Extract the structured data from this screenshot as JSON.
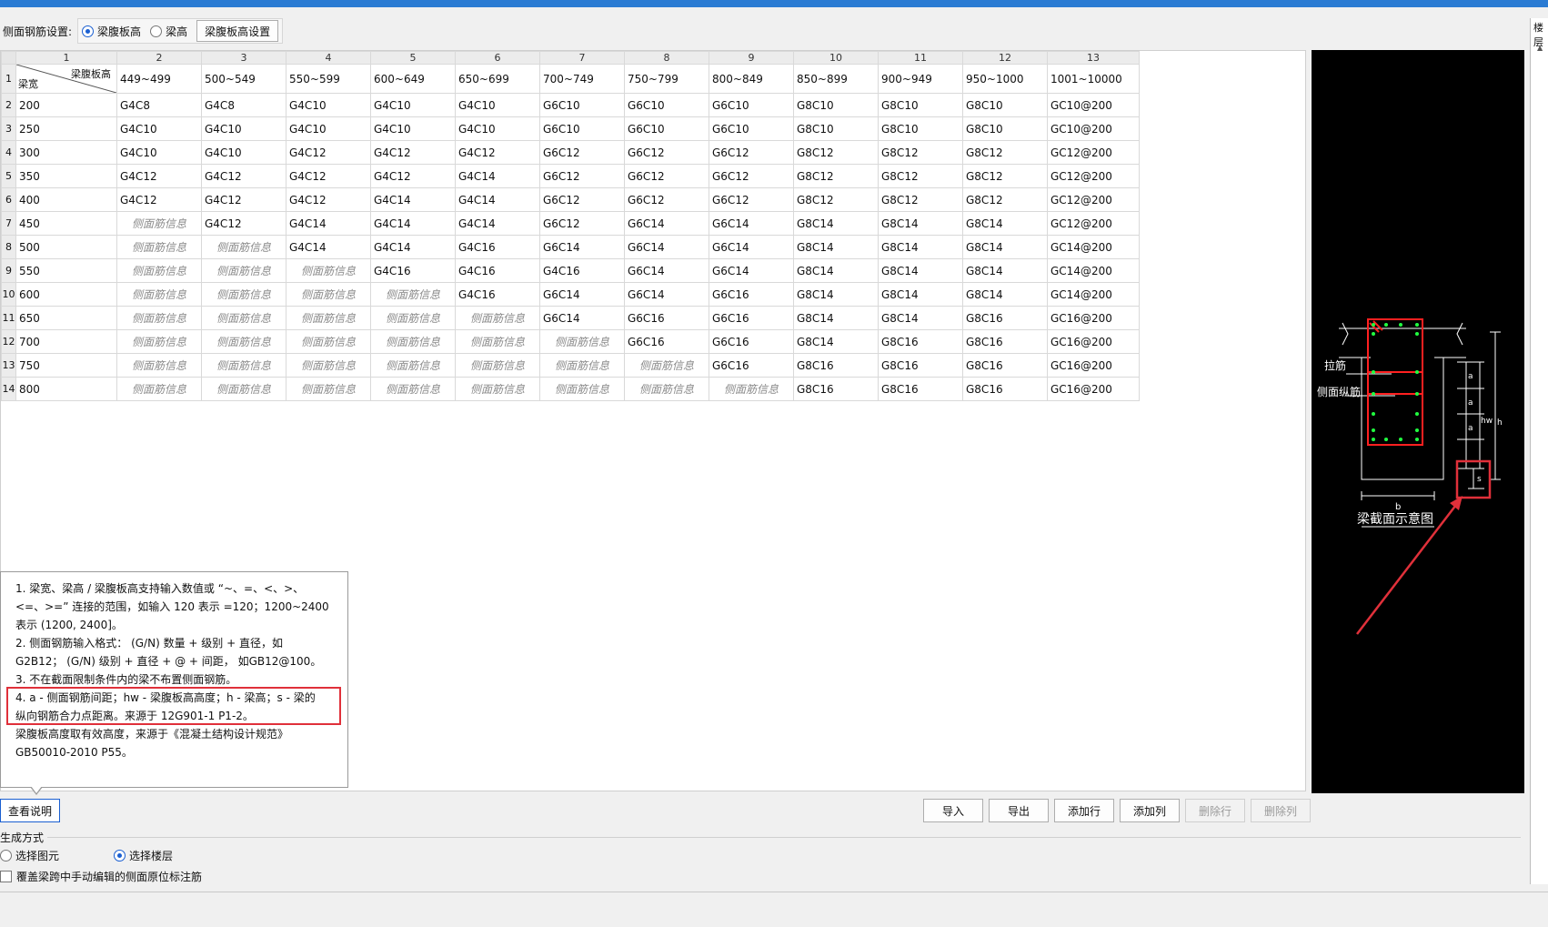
{
  "setting": {
    "label": "侧面钢筋设置:",
    "radio_web_height": "梁腹板高",
    "radio_beam_height": "梁高",
    "web_height_settings_button": "梁腹板高设置"
  },
  "grid": {
    "col_numbers": [
      "1",
      "2",
      "3",
      "4",
      "5",
      "6",
      "7",
      "8",
      "9",
      "10",
      "11",
      "12",
      "13"
    ],
    "corner_top": "梁腹板高",
    "corner_bottom": "梁宽",
    "header_ranges": [
      "449~499",
      "500~549",
      "550~599",
      "600~649",
      "650~699",
      "700~749",
      "750~799",
      "800~849",
      "850~899",
      "900~949",
      "950~1000",
      "1001~10000"
    ],
    "placeholder": "侧面筋信息",
    "rows": [
      {
        "no": "2",
        "width": "200",
        "cells": [
          "G4C8",
          "G4C8",
          "G4C10",
          "G4C10",
          "G4C10",
          "G6C10",
          "G6C10",
          "G6C10",
          "G8C10",
          "G8C10",
          "G8C10",
          "GC10@200"
        ]
      },
      {
        "no": "3",
        "width": "250",
        "cells": [
          "G4C10",
          "G4C10",
          "G4C10",
          "G4C10",
          "G4C10",
          "G6C10",
          "G6C10",
          "G6C10",
          "G8C10",
          "G8C10",
          "G8C10",
          "GC10@200"
        ]
      },
      {
        "no": "4",
        "width": "300",
        "cells": [
          "G4C10",
          "G4C10",
          "G4C12",
          "G4C12",
          "G4C12",
          "G6C12",
          "G6C12",
          "G6C12",
          "G8C12",
          "G8C12",
          "G8C12",
          "GC12@200"
        ]
      },
      {
        "no": "5",
        "width": "350",
        "cells": [
          "G4C12",
          "G4C12",
          "G4C12",
          "G4C12",
          "G4C14",
          "G6C12",
          "G6C12",
          "G6C12",
          "G8C12",
          "G8C12",
          "G8C12",
          "GC12@200"
        ]
      },
      {
        "no": "6",
        "width": "400",
        "cells": [
          "G4C12",
          "G4C12",
          "G4C12",
          "G4C14",
          "G4C14",
          "G6C12",
          "G6C12",
          "G6C12",
          "G8C12",
          "G8C12",
          "G8C12",
          "GC12@200"
        ]
      },
      {
        "no": "7",
        "width": "450",
        "cells": [
          "",
          "G4C12",
          "G4C14",
          "G4C14",
          "G4C14",
          "G6C12",
          "G6C14",
          "G6C14",
          "G8C14",
          "G8C14",
          "G8C14",
          "GC12@200"
        ]
      },
      {
        "no": "8",
        "width": "500",
        "cells": [
          "",
          "",
          "G4C14",
          "G4C14",
          "G4C16",
          "G6C14",
          "G6C14",
          "G6C14",
          "G8C14",
          "G8C14",
          "G8C14",
          "GC14@200"
        ]
      },
      {
        "no": "9",
        "width": "550",
        "cells": [
          "",
          "",
          "",
          "G4C16",
          "G4C16",
          "G4C16",
          "G6C14",
          "G6C14",
          "G8C14",
          "G8C14",
          "G8C14",
          "GC14@200"
        ]
      },
      {
        "no": "10",
        "width": "600",
        "cells": [
          "",
          "",
          "",
          "",
          "G4C16",
          "G6C14",
          "G6C14",
          "G6C16",
          "G8C14",
          "G8C14",
          "G8C14",
          "GC14@200"
        ]
      },
      {
        "no": "11",
        "width": "650",
        "cells": [
          "",
          "",
          "",
          "",
          "",
          "G6C14",
          "G6C16",
          "G6C16",
          "G8C14",
          "G8C14",
          "G8C16",
          "GC16@200"
        ]
      },
      {
        "no": "12",
        "width": "700",
        "cells": [
          "",
          "",
          "",
          "",
          "",
          "",
          "G6C16",
          "G6C16",
          "G8C14",
          "G8C16",
          "G8C16",
          "GC16@200"
        ]
      },
      {
        "no": "13",
        "width": "750",
        "cells": [
          "",
          "",
          "",
          "",
          "",
          "",
          "",
          "G6C16",
          "G8C16",
          "G8C16",
          "G8C16",
          "GC16@200"
        ]
      },
      {
        "no": "14",
        "width": "800",
        "cells": [
          "",
          "",
          "",
          "",
          "",
          "",
          "",
          "",
          "G8C16",
          "G8C16",
          "G8C16",
          "GC16@200"
        ]
      }
    ]
  },
  "notes": [
    "1. 梁宽、梁高 / 梁腹板高支持输入数值或 “~、=、<、>、",
    "<=、>=” 连接的范围，如输入 120 表示 =120；1200~2400",
    "表示 (1200, 2400]。",
    "2. 侧面钢筋输入格式： (G/N) 数量 + 级别 + 直径，如",
    "G2B12； (G/N) 级别 + 直径 + @ + 间距， 如GB12@100。",
    "3. 不在截面限制条件内的梁不布置侧面钢筋。",
    "4. a - 侧面钢筋间距；hw - 梁腹板高高度；h - 梁高；s - 梁的",
    "纵向钢筋合力点距离。来源于 12G901-1 P1-2。",
    "梁腹板高度取有效高度，来源于《混凝土结构设计规范》",
    "GB50010-2010 P55。"
  ],
  "diagram": {
    "tie_label": "拉筋",
    "side_bar_label": "侧面纵筋",
    "title": "梁截面示意图",
    "dim_a": "a",
    "dim_hw": "hw",
    "dim_h": "h",
    "dim_s": "s",
    "dim_b": "b"
  },
  "buttons": {
    "view_notes": "查看说明",
    "import": "导入",
    "export": "导出",
    "add_row": "添加行",
    "add_col": "添加列",
    "delete_row": "删除行",
    "delete_col": "删除列"
  },
  "generate": {
    "title": "生成方式",
    "opt_element": "选择图元",
    "opt_floor": "选择楼层",
    "overwrite_label": "覆盖梁跨中手动编辑的侧面原位标注筋"
  },
  "side": {
    "label": "楼层"
  },
  "colors": {
    "accent": "#1a5fd1",
    "highlight": "#e0303a",
    "rebar": "#ff2020",
    "dot": "#20ff40"
  }
}
